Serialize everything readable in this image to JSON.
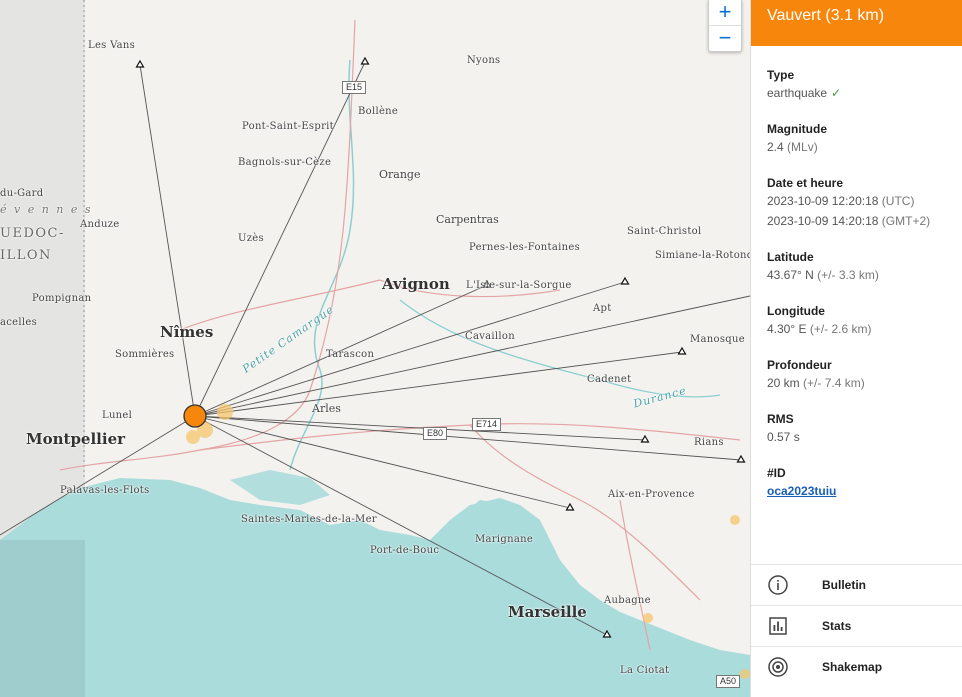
{
  "map": {
    "places": {
      "les_vans": "Les Vans",
      "nyons": "Nyons",
      "pont_saint_esprit": "Pont-Saint-Esprit",
      "bollene": "Bollène",
      "bagnols": "Bagnols-sur-Cèze",
      "orange": "Orange",
      "carpentras": "Carpentras",
      "pernes": "Pernes-les-Fontaines",
      "saint_christol": "Saint-Christol",
      "simiane": "Simiane-la-Rotond",
      "uzes": "Uzès",
      "anduze": "Anduze",
      "du_gard": "du-Gard",
      "cevennes": "é v e n n e s",
      "languedoc": "UEDOC-",
      "roussillon": "ILLON",
      "avignon": "Avignon",
      "isle_sorgue": "L'Isle-sur-la-Sorgue",
      "pompignan": "Pompignan",
      "apt": "Apt",
      "vacelles": "acelles",
      "nimes": "Nîmes",
      "tarascon": "Tarascon",
      "cavaillon": "Cavaillon",
      "manosque": "Manosque",
      "sommieres": "Sommières",
      "petite_camargue": "Petite Camargue",
      "cadenet": "Cadenet",
      "lunel": "Lunel",
      "arles": "Arles",
      "durance": "Durance",
      "montpellier": "Montpellier",
      "rians": "Rians",
      "palavas": "Palavas-les-Flots",
      "aix": "Aix-en-Provence",
      "saintes_maries": "Saintes-Maries-de-la-Mer",
      "marignane": "Marignane",
      "port_de_bouc": "Port-de-Bouc",
      "marseille": "Marseille",
      "aubagne": "Aubagne",
      "la_ciotat": "La Ciotat"
    },
    "roads": {
      "e15": "E15",
      "e714": "E714",
      "e80": "E80",
      "a50": "A50"
    },
    "zoom": {
      "in": "+",
      "out": "−"
    },
    "colors": {
      "epicenter": "#f7860c",
      "sea": "#abdcdc",
      "station": "#111111"
    }
  },
  "panel": {
    "title": "Vauvert (3.1 km)",
    "type_label": "Type",
    "type_value": "earthquake",
    "magnitude_label": "Magnitude",
    "magnitude_value": "2.4",
    "magnitude_unit": "(MLv)",
    "date_label": "Date et heure",
    "date_utc": "2023-10-09 12:20:18",
    "date_utc_tz": "(UTC)",
    "date_local": "2023-10-09 14:20:18",
    "date_local_tz": "(GMT+2)",
    "latitude_label": "Latitude",
    "latitude_value": "43.67° N",
    "latitude_err": "(+/- 3.3 km)",
    "longitude_label": "Longitude",
    "longitude_value": "4.30° E",
    "longitude_err": "(+/- 2.6 km)",
    "depth_label": "Profondeur",
    "depth_value": "20 km",
    "depth_err": "(+/- 7.4 km)",
    "rms_label": "RMS",
    "rms_value": "0.57 s",
    "id_label": "#ID",
    "id_value": "oca2023tuiu",
    "actions": {
      "bulletin": "Bulletin",
      "stats": "Stats",
      "shakemap": "Shakemap"
    },
    "colors": {
      "header": "#f7860c",
      "link": "#1a5fb4"
    }
  }
}
